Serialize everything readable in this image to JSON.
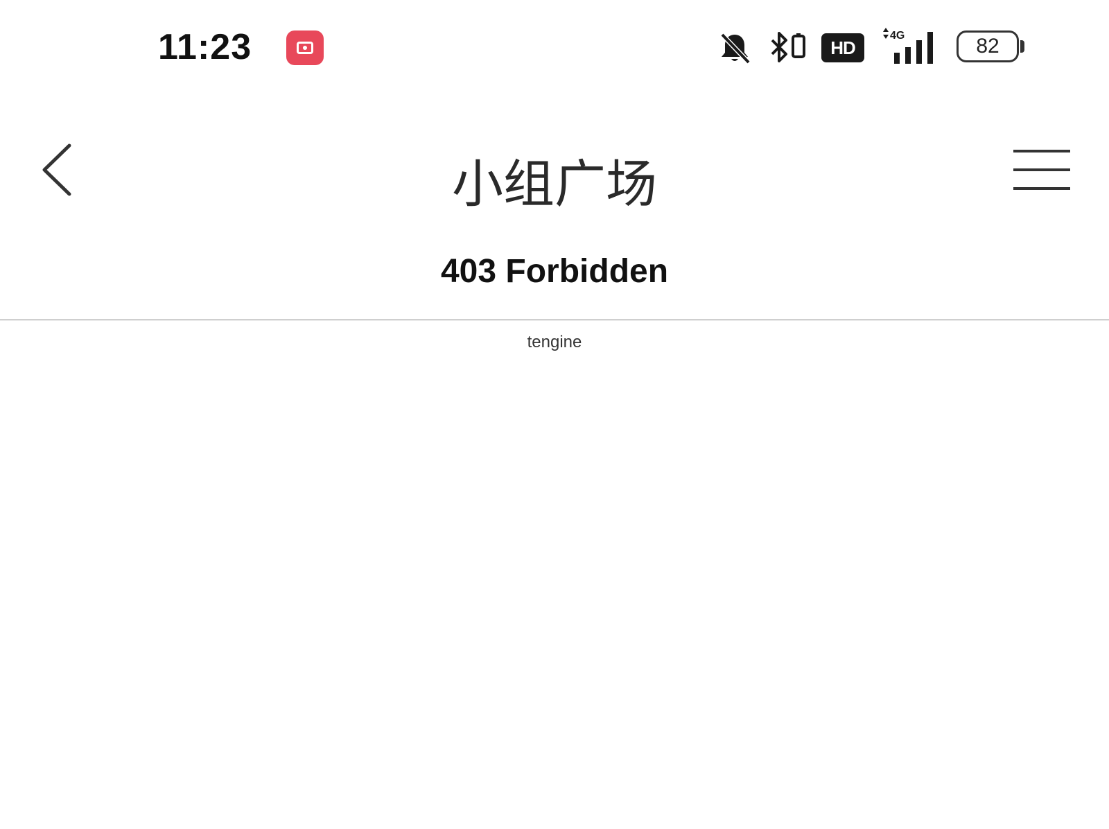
{
  "status_bar": {
    "time": "11:23",
    "record_icon": "screen-record-icon",
    "record_color": "#e8485a",
    "icons": [
      "bell-off-icon",
      "bluetooth-icon",
      "hd-voice-icon",
      "signal-4g-icon"
    ],
    "hd_label": "HD",
    "network_label": "4G",
    "battery_level": "82"
  },
  "nav": {
    "back_icon": "chevron-left-icon",
    "title": "小组广场",
    "menu_icon": "hamburger-menu-icon"
  },
  "content": {
    "error_title": "403 Forbidden",
    "server": "tengine"
  }
}
